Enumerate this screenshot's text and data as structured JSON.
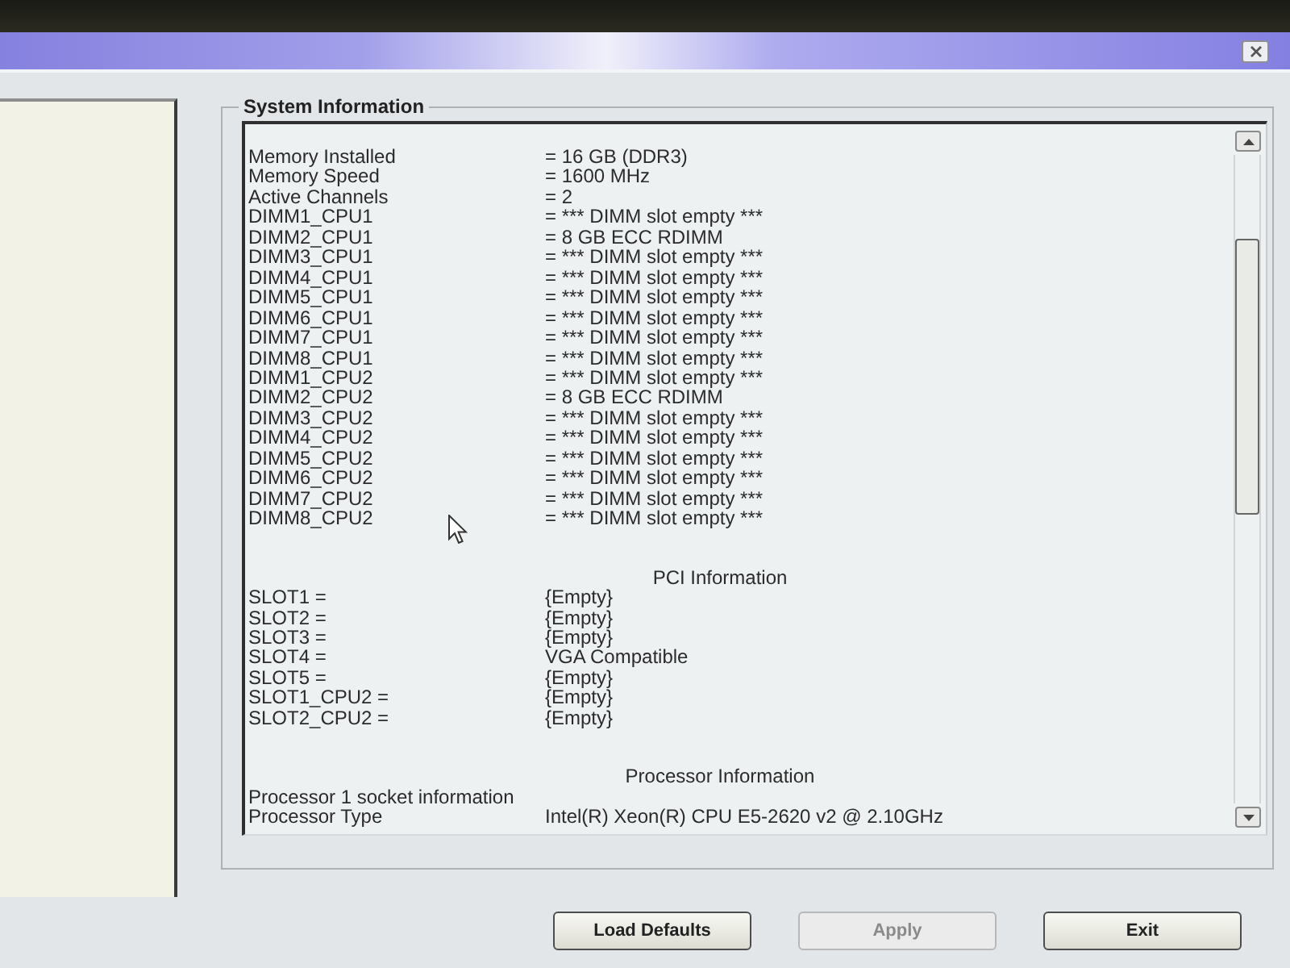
{
  "system_information": {
    "title": "System Information",
    "sections": [
      {
        "rows": [
          {
            "label": "Memory Installed",
            "value": "= 16 GB (DDR3)"
          },
          {
            "label": "Memory Speed",
            "value": "= 1600 MHz"
          },
          {
            "label": "Active Channels",
            "value": "= 2"
          },
          {
            "label": "DIMM1_CPU1",
            "value": "= *** DIMM slot empty ***"
          },
          {
            "label": "DIMM2_CPU1",
            "value": "= 8 GB ECC RDIMM"
          },
          {
            "label": "DIMM3_CPU1",
            "value": "= *** DIMM slot empty ***"
          },
          {
            "label": "DIMM4_CPU1",
            "value": "= *** DIMM slot empty ***"
          },
          {
            "label": "DIMM5_CPU1",
            "value": "= *** DIMM slot empty ***"
          },
          {
            "label": "DIMM6_CPU1",
            "value": "= *** DIMM slot empty ***"
          },
          {
            "label": "DIMM7_CPU1",
            "value": "= *** DIMM slot empty ***"
          },
          {
            "label": "DIMM8_CPU1",
            "value": "= *** DIMM slot empty ***"
          },
          {
            "label": "DIMM1_CPU2",
            "value": "= *** DIMM slot empty ***"
          },
          {
            "label": "DIMM2_CPU2",
            "value": "= 8 GB ECC RDIMM"
          },
          {
            "label": "DIMM3_CPU2",
            "value": "= *** DIMM slot empty ***"
          },
          {
            "label": "DIMM4_CPU2",
            "value": "= *** DIMM slot empty ***"
          },
          {
            "label": "DIMM5_CPU2",
            "value": "= *** DIMM slot empty ***"
          },
          {
            "label": "DIMM6_CPU2",
            "value": "= *** DIMM slot empty ***"
          },
          {
            "label": "DIMM7_CPU2",
            "value": "= *** DIMM slot empty ***"
          },
          {
            "label": "DIMM8_CPU2",
            "value": "= *** DIMM slot empty ***"
          }
        ]
      },
      {
        "heading": "PCI Information",
        "rows": [
          {
            "label": "SLOT1 =",
            "value": "{Empty}"
          },
          {
            "label": "SLOT2 =",
            "value": "{Empty}"
          },
          {
            "label": "SLOT3 =",
            "value": "{Empty}"
          },
          {
            "label": "SLOT4 =",
            "value": "VGA Compatible"
          },
          {
            "label": "SLOT5 =",
            "value": "{Empty}"
          },
          {
            "label": "SLOT1_CPU2 =",
            "value": "{Empty}"
          },
          {
            "label": "SLOT2_CPU2 =",
            "value": "{Empty}"
          }
        ]
      },
      {
        "heading": "Processor Information",
        "rows": [
          {
            "label": "Processor 1 socket information"
          },
          {
            "label": "Processor Type",
            "value": "Intel(R) Xeon(R) CPU E5-2620 v2 @ 2.10GHz"
          }
        ]
      }
    ]
  },
  "buttons": [
    {
      "label": "Load Defaults",
      "disabled": false
    },
    {
      "label": "Apply",
      "disabled": true
    },
    {
      "label": "Exit",
      "disabled": false
    }
  ]
}
